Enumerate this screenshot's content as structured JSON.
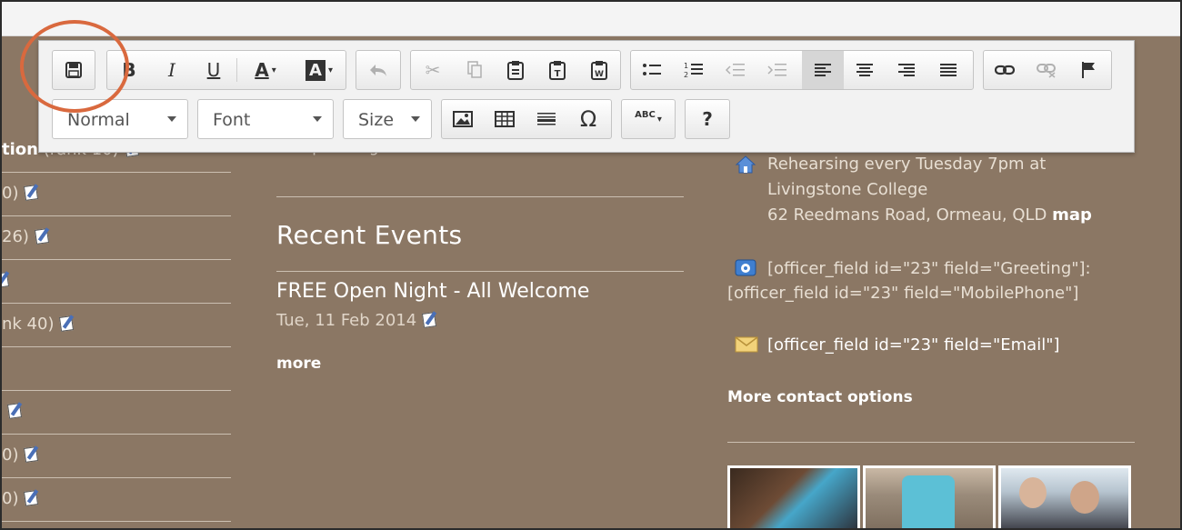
{
  "toolbar": {
    "format_combo": "Normal",
    "font_combo": "Font",
    "size_combo": "Size",
    "spellcheck_label": "ABC",
    "help_label": "?",
    "bold": "B",
    "italic": "I",
    "underline": "U",
    "text_color": "A",
    "bg_color": "A"
  },
  "left": {
    "rows": [
      {
        "prefix": "tion",
        "rest": " (rank 10)",
        "edit": true
      },
      {
        "prefix": "",
        "rest": "0)",
        "edit": true
      },
      {
        "prefix": "",
        "rest": "26)",
        "edit": true
      },
      {
        "prefix": "",
        "rest": "",
        "edit": true
      },
      {
        "prefix": "",
        "rest": "nk 40)",
        "edit": true
      },
      {
        "prefix": "",
        "rest": "",
        "edit": false
      },
      {
        "prefix": "",
        "rest": "",
        "edit": true
      },
      {
        "prefix": "",
        "rest": "0)",
        "edit": true
      },
      {
        "prefix": "",
        "rest": "0)",
        "edit": true
      }
    ]
  },
  "middle": {
    "upcoming": "No upcoming events",
    "recent_title": "Recent Events",
    "event_title": "FREE Open Night - All Welcome",
    "event_date": "Tue, 11 Feb 2014",
    "more": "more"
  },
  "right": {
    "address_line1": "Rehearsing every Tuesday 7pm at",
    "address_line2": "Livingstone College",
    "address_line3": "62 Reedmans Road, Ormeau, QLD",
    "map_link": "map",
    "phone_line1": "[officer_field id=\"23\" field=\"Greeting\"]:",
    "phone_line2": "[officer_field id=\"23\" field=\"MobilePhone\"]",
    "email": "[officer_field id=\"23\" field=\"Email\"]",
    "contact_link": "More contact options"
  }
}
